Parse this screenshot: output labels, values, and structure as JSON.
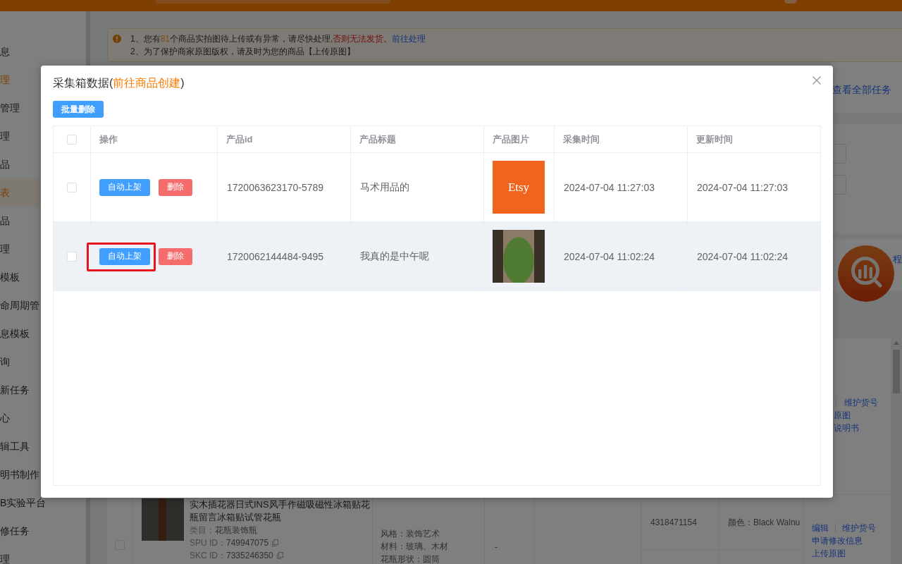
{
  "sidebar": {
    "items": [
      {
        "label": "息",
        "selected": false,
        "open": false
      },
      {
        "label": "理",
        "selected": false,
        "open": true
      },
      {
        "label": "管理",
        "selected": false,
        "open": false
      },
      {
        "label": "理",
        "selected": false,
        "open": false
      },
      {
        "label": "品",
        "selected": false,
        "open": false
      },
      {
        "label": "表",
        "selected": true,
        "open": false
      },
      {
        "label": "品",
        "selected": false,
        "open": false
      },
      {
        "label": "理",
        "selected": false,
        "open": false
      },
      {
        "label": "模板",
        "selected": false,
        "open": false
      },
      {
        "label": "命周期管",
        "selected": false,
        "open": false
      },
      {
        "label": "息模板",
        "selected": false,
        "open": false
      },
      {
        "label": "询",
        "selected": false,
        "open": false
      },
      {
        "label": "新任务",
        "selected": false,
        "open": false
      },
      {
        "label": "心",
        "selected": false,
        "open": false
      },
      {
        "label": "辑工具",
        "selected": false,
        "open": false
      },
      {
        "label": "明书制作",
        "selected": false,
        "open": false
      },
      {
        "label": "B实验平台",
        "selected": false,
        "open": false
      },
      {
        "label": "修任务",
        "selected": false,
        "open": false
      },
      {
        "label": "理",
        "selected": false,
        "open": false
      }
    ]
  },
  "notice": {
    "lines": [
      [
        {
          "kind": "text",
          "text": "1、您有"
        },
        {
          "kind": "count",
          "text": "81"
        },
        {
          "kind": "text",
          "text": "个商品实拍图待上传或有异常，请尽快处理,"
        },
        {
          "kind": "alert",
          "text": "否则无法发货。"
        },
        {
          "kind": "link",
          "text": "前往处理"
        }
      ],
      [
        {
          "kind": "text",
          "text": "2、为了保护商家原图版权，请及时为您的商品【上传原图】"
        }
      ]
    ]
  },
  "task_panel": {
    "view_all_link": "查看全部任务"
  },
  "help_panel": {
    "link": "程"
  },
  "list_table": {
    "previous_row_actions": [
      "维护货号",
      "原图",
      "说明书"
    ],
    "product_row": {
      "checked": false,
      "title": "实木插花器日式INS风手作磁吸磁性冰箱贴花瓶留言冰箱贴试管花瓶",
      "category_label": "类目：",
      "category": "花瓶装饰瓶",
      "spu_label": "SPU ID：",
      "spu_id": "749947075",
      "skc_label": "SKC ID：",
      "skc_id": "7335246350",
      "attributes": [
        "风格：装饰艺术",
        "材料：玻璃、木材",
        "花瓶形状：圆筒"
      ],
      "column_4": "-",
      "sku_rows": [
        {
          "column_7": "4318471154",
          "column_8": "颜色：Black Walnu"
        }
      ],
      "actions": [
        "编辑",
        "维护货号",
        "申请修改信息",
        "上传原图"
      ]
    }
  },
  "modal": {
    "title": [
      {
        "kind": "text",
        "text": "采集箱数据("
      },
      {
        "kind": "link",
        "text": "前往商品创建"
      },
      {
        "kind": "text",
        "text": ")"
      }
    ],
    "batch_delete": "批量删除",
    "table": {
      "header_checked": false,
      "columns": [
        "操作",
        "产品id",
        "产品标题",
        "产品图片",
        "采集时间",
        "更新时间"
      ],
      "rows": [
        {
          "checked": false,
          "hover": false,
          "actions": [
            {
              "kind": "primary",
              "label": "自动上架",
              "annotated": false
            },
            {
              "kind": "danger",
              "label": "删除",
              "annotated": false
            }
          ],
          "product_id": "1720063623170-5789",
          "title": "马术用品的",
          "image": {
            "kind": "logo",
            "text": "Etsy"
          },
          "collected_at": "2024-07-04 11:27:03",
          "updated_at": "2024-07-04 11:27:03"
        },
        {
          "checked": false,
          "hover": true,
          "actions": [
            {
              "kind": "primary",
              "label": "自动上架",
              "annotated": true
            },
            {
              "kind": "danger",
              "label": "删除",
              "annotated": false
            }
          ],
          "product_id": "1720062144484-9495",
          "title": "我真的是中午呢",
          "image": {
            "kind": "photo"
          },
          "collected_at": "2024-07-04 11:02:24",
          "updated_at": "2024-07-04 11:02:24"
        }
      ]
    }
  }
}
